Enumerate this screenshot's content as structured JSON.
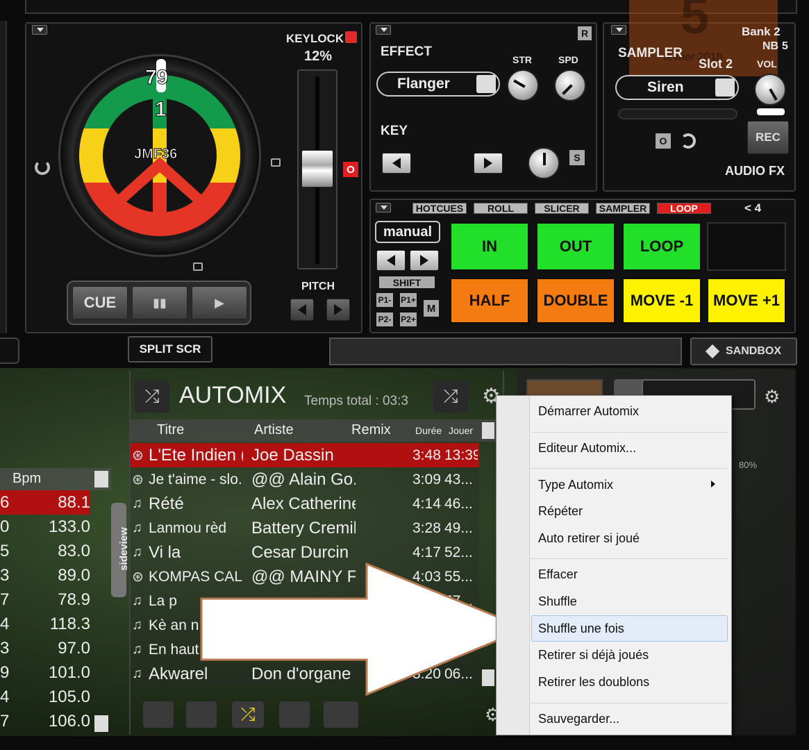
{
  "deck": {
    "keylock_label": "KEYLOCK",
    "keylock_pct": "12%",
    "turntable_text": "JMF36",
    "turntable_digits": "79",
    "turntable_digits2": "1",
    "pitch_label": "PITCH",
    "cue_label": "CUE",
    "o_badge": "O",
    "split_label": "SPLIT SCR"
  },
  "effect": {
    "title": "EFFECT",
    "r_badge": "R",
    "str_label": "STR",
    "spd_label": "SPD",
    "selected": "Flanger",
    "key_label": "KEY",
    "s_badge": "S"
  },
  "sampler": {
    "title": "SAMPLER",
    "bank": "Bank 2",
    "nb": "NB",
    "nb_value": "5",
    "slot": "Slot 2",
    "vol": "VOL",
    "selected": "Siren",
    "o_badge": "O",
    "rec_label": "REC",
    "audiofx_label": "AUDIO FX",
    "bg_date": "février 2018",
    "bg_digit": "5"
  },
  "pads": {
    "tabs": [
      "HOTCUES",
      "ROLL",
      "SLICER",
      "SAMPLER",
      "LOOP"
    ],
    "loop_size": "< 4",
    "mode": "manual",
    "shift_label": "SHIFT",
    "p_buttons": [
      "P1-",
      "P1+",
      "P2-",
      "P2+"
    ],
    "m_label": "M",
    "row1": [
      "IN",
      "OUT",
      "LOOP",
      ""
    ],
    "row2": [
      "HALF",
      "DOUBLE",
      "MOVE -1",
      "MOVE +1"
    ]
  },
  "toolbar": {
    "sandbox_label": "SANDBOX"
  },
  "automix": {
    "title": "AUTOMIX",
    "total": "Temps total : 03:3",
    "sideview": "sideview",
    "headers": {
      "titre": "Titre",
      "artiste": "Artiste",
      "remix": "Remix",
      "duree": "Durée",
      "jouer": "Jouer"
    },
    "rows": [
      {
        "title": "L'Ete Indien (19",
        "artist": "Joe Dassin",
        "dur": "3:48",
        "play": "13:39",
        "icon": "disc"
      },
      {
        "title": "Je t'aime - slo...",
        "artist": "@@ Alain Go...",
        "dur": "3:09",
        "play": "43...",
        "icon": "disc"
      },
      {
        "title": "Rété",
        "artist": "Alex Catherine",
        "dur": "4:14",
        "play": "46...",
        "icon": "note"
      },
      {
        "title": "Lanmou rèd",
        "artist": "Battery Cremil",
        "dur": "3:28",
        "play": "49...",
        "icon": "note"
      },
      {
        "title": "Vi la",
        "artist": "Cesar Durcin",
        "dur": "4:17",
        "play": "52...",
        "icon": "note"
      },
      {
        "title": "KOMPAS CAL...",
        "artist": "@@ MAINY F...",
        "dur": "4:03",
        "play": "55...",
        "icon": "disc"
      },
      {
        "title": "La p",
        "artist": "",
        "dur": "",
        "play": "57...",
        "icon": "note"
      },
      {
        "title": "Kè an n",
        "artist": "",
        "dur": "",
        "play": "",
        "icon": "note"
      },
      {
        "title": "En haut",
        "artist": "",
        "dur": "",
        "play": "",
        "icon": "note"
      },
      {
        "title": "Akwarel",
        "artist": "Don d'organe",
        "dur": "3:20",
        "play": "06...",
        "icon": "note"
      }
    ]
  },
  "bpm": {
    "header": "Bpm",
    "rows": [
      {
        "key": "6",
        "bpm": "88.1"
      },
      {
        "key": "0",
        "bpm": "133.0"
      },
      {
        "key": "5",
        "bpm": "83.0"
      },
      {
        "key": "3",
        "bpm": "89.0"
      },
      {
        "key": "7",
        "bpm": "78.9"
      },
      {
        "key": "4",
        "bpm": "118.3"
      },
      {
        "key": "3",
        "bpm": "97.0"
      },
      {
        "key": "9",
        "bpm": "101.0"
      },
      {
        "key": "4",
        "bpm": "105.0"
      },
      {
        "key": "7",
        "bpm": "106.0"
      }
    ]
  },
  "context_menu": {
    "items": [
      "Démarrer Automix",
      "Editeur Automix...",
      "Type Automix",
      "Répéter",
      "Auto retirer si joué",
      "Effacer",
      "Shuffle",
      "Shuffle une fois",
      "Retirer si déjà joués",
      "Retirer les doublons",
      "Sauvegarder..."
    ]
  },
  "gauge_label": "80%"
}
